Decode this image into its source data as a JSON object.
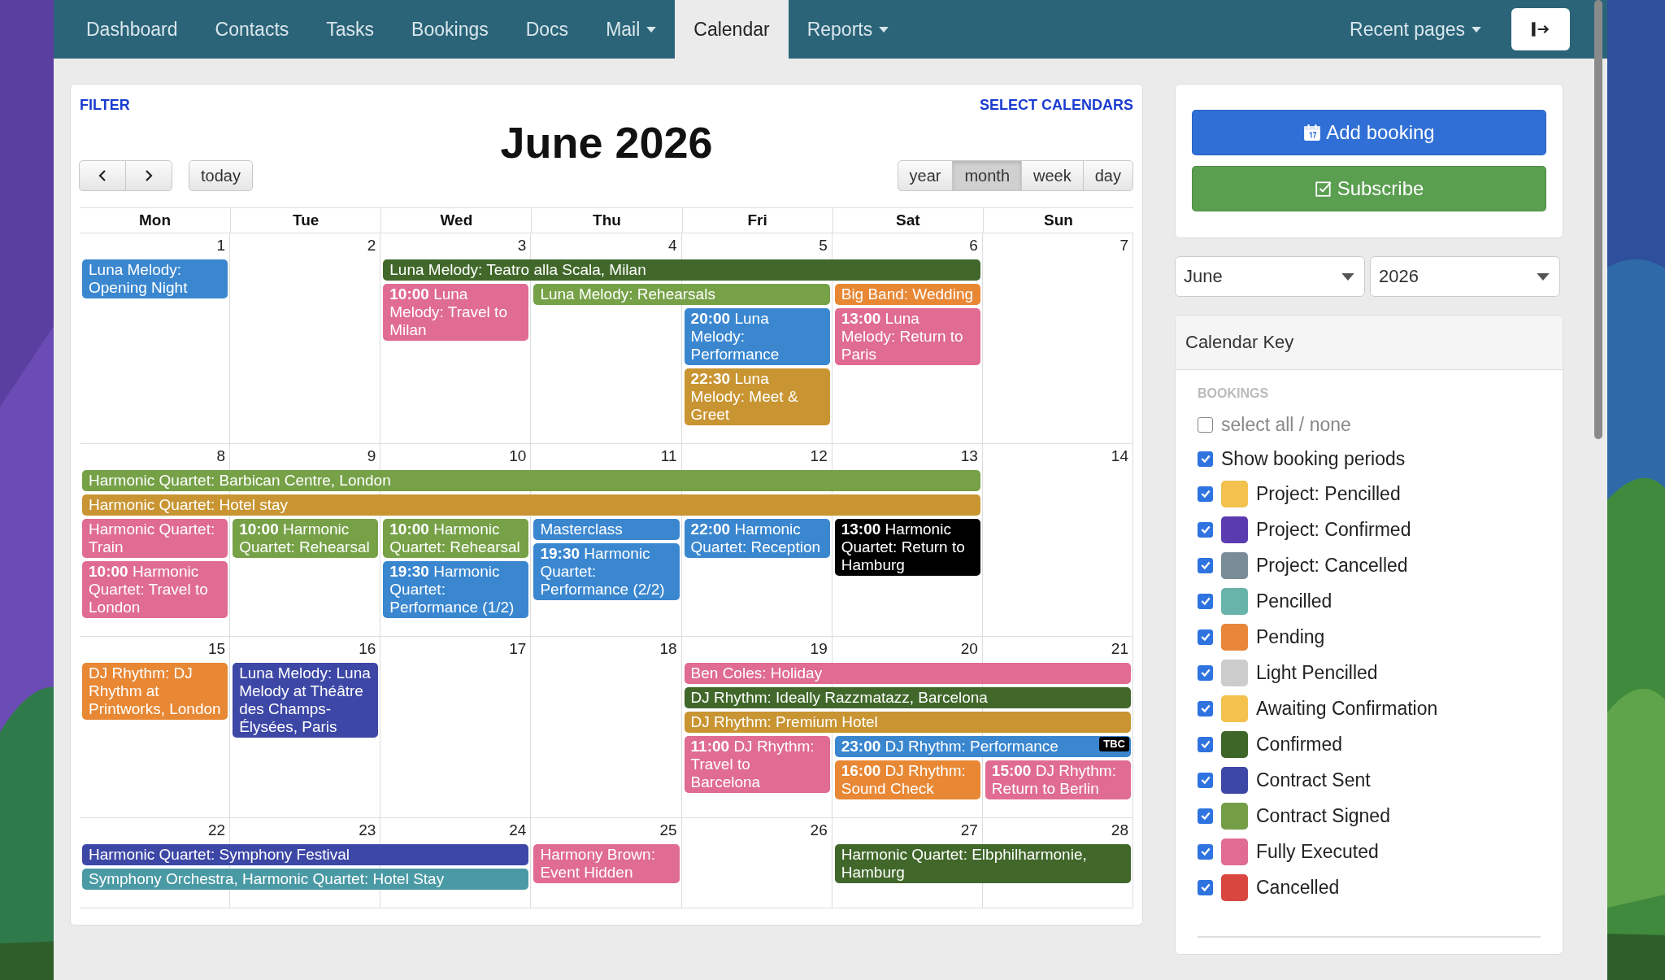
{
  "nav": {
    "items": [
      {
        "label": "Dashboard",
        "selected": false,
        "dropdown": false
      },
      {
        "label": "Contacts",
        "selected": false,
        "dropdown": false
      },
      {
        "label": "Tasks",
        "selected": false,
        "dropdown": false
      },
      {
        "label": "Bookings",
        "selected": false,
        "dropdown": false
      },
      {
        "label": "Docs",
        "selected": false,
        "dropdown": false
      },
      {
        "label": "Mail",
        "selected": false,
        "dropdown": true
      },
      {
        "label": "Calendar",
        "selected": true,
        "dropdown": false
      },
      {
        "label": "Reports",
        "selected": false,
        "dropdown": true
      }
    ],
    "recent": {
      "label": "Recent pages",
      "dropdown": true
    }
  },
  "calendar": {
    "filter": "FILTER",
    "select_calendars": "SELECT CALENDARS",
    "title": "June 2026",
    "today": "today",
    "views": [
      {
        "label": "year",
        "selected": false
      },
      {
        "label": "month",
        "selected": true
      },
      {
        "label": "week",
        "selected": false
      },
      {
        "label": "day",
        "selected": false
      }
    ],
    "weekdays": [
      "Mon",
      "Tue",
      "Wed",
      "Thu",
      "Fri",
      "Sat",
      "Sun"
    ],
    "weeks": [
      {
        "days": [
          {
            "date": "1",
            "events": [
              {
                "text": "Luna Melody: Opening Night",
                "color": "#3a87d0",
                "kind": "one-day"
              }
            ]
          },
          {
            "date": "2"
          },
          {
            "date": "3",
            "events": [
              {
                "text": "Luna Melody: Teatro alla Scala, Milan",
                "color": "#41682a",
                "kind": "four-days"
              },
              {
                "text": "**10:00** Luna Melody: Travel to Milan",
                "color": "#e06b93",
                "kind": "one-day"
              }
            ]
          },
          {
            "date": "4",
            "events": [
              {
                "text": "Luna Melody: Rehearsals",
                "color": "#76a147",
                "kind": "two-days"
              }
            ]
          },
          {
            "date": "5",
            "events": [
              {
                "text": "**20:00** Luna Melody: Performance",
                "color": "#3a87d0",
                "kind": "one-day"
              },
              {
                "text": "**22:30** Luna Melody: Meet & Greet",
                "color": "#c99532",
                "kind": "one-day"
              }
            ]
          },
          {
            "date": "6",
            "events": [
              {
                "text": "Big Band: Wedding",
                "color": "#e88734",
                "kind": "one-day"
              },
              {
                "text": "**13:00** Luna Melody: Return to Paris",
                "color": "#e06b93",
                "kind": "one-day"
              }
            ]
          },
          {
            "date": "7"
          }
        ]
      },
      {
        "days": [
          {
            "date": "8",
            "events": [
              {
                "text": "Harmonic Quartet: Barbican Centre, London",
                "color": "#76a147",
                "kind": "six-days"
              },
              {
                "text": "Harmonic Quartet: Hotel stay",
                "color": "#c99532",
                "kind": "six-days"
              },
              {
                "text": "Harmonic Quartet: Train",
                "color": "#e06b93",
                "kind": "one-day"
              },
              {
                "text": "**10:00** Harmonic Quartet: Travel to London",
                "color": "#e06b93",
                "kind": "one-day"
              }
            ]
          },
          {
            "date": "9",
            "events": [
              {
                "text": "**10:00** Harmonic Quartet: Rehearsal",
                "color": "#76a147",
                "kind": "one-day"
              }
            ]
          },
          {
            "date": "10",
            "events": [
              {
                "text": "**10:00** Harmonic Quartet: Rehearsal",
                "color": "#76a147",
                "kind": "one-day"
              },
              {
                "text": "**19:30** Harmonic Quartet: Performance (1/2)",
                "color": "#3a87d0",
                "kind": "one-day"
              }
            ]
          },
          {
            "date": "11",
            "events": [
              {
                "text": "Masterclass",
                "color": "#3a87d0",
                "kind": "one-day"
              },
              {
                "text": "**19:30** Harmonic Quartet: Performance (2/2)",
                "color": "#3a87d0",
                "kind": "one-day"
              }
            ]
          },
          {
            "date": "12",
            "events": [
              {
                "text": "**22:00** Harmonic Quartet: Reception",
                "color": "#3a87d0",
                "kind": "one-day"
              }
            ]
          },
          {
            "date": "13",
            "events": [
              {
                "text": "**13:00** Harmonic Quartet: Return to Hamburg",
                "color": "#000000",
                "kind": "one-day"
              }
            ]
          },
          {
            "date": "14"
          }
        ]
      },
      {
        "days": [
          {
            "date": "15",
            "events": [
              {
                "text": "DJ Rhythm: DJ Rhythm at Printworks, London",
                "color": "#e88734",
                "kind": "one-day"
              }
            ]
          },
          {
            "date": "16",
            "events": [
              {
                "text": "Luna Melody: Luna Melody at Théâtre des Champs-Élysées, Paris",
                "color": "#3d47a6",
                "kind": "one-day"
              }
            ]
          },
          {
            "date": "17"
          },
          {
            "date": "18"
          },
          {
            "date": "19",
            "events": [
              {
                "text": "Ben Coles: Holiday",
                "color": "#e06b93",
                "kind": "three-days"
              },
              {
                "text": "DJ Rhythm: Ideally Razzmatazz, Barcelona",
                "color": "#41682a",
                "kind": "three-days"
              },
              {
                "text": "DJ Rhythm: Premium Hotel",
                "color": "#c99532",
                "kind": "three-days"
              },
              {
                "text": "**11:00** DJ Rhythm: Travel to Barcelona",
                "color": "#e06b93",
                "kind": "one-day"
              }
            ]
          },
          {
            "date": "20",
            "events": [
              {
                "text": "**23:00** DJ Rhythm: Performance",
                "color": "#3a87d0",
                "kind": "two-days",
                "badge": "TBC"
              },
              {
                "text": "**16:00** DJ Rhythm: Sound Check",
                "color": "#e88734",
                "kind": "one-day"
              }
            ]
          },
          {
            "date": "21",
            "events": [
              {
                "text": "**15:00** DJ Rhythm: Return to Berlin",
                "color": "#e06b93",
                "kind": "one-day"
              }
            ]
          }
        ]
      },
      {
        "days": [
          {
            "date": "22",
            "events": [
              {
                "text": "Harmonic Quartet: Symphony Festival",
                "color": "#3d47a6",
                "kind": "three-days"
              },
              {
                "text": "Symphony Orchestra, Harmonic Quartet: Hotel Stay",
                "color": "#4a9aa5",
                "kind": "three-days"
              }
            ]
          },
          {
            "date": "23"
          },
          {
            "date": "24"
          },
          {
            "date": "25",
            "events": [
              {
                "text": "Harmony Brown: Event Hidden",
                "color": "#e06b93",
                "kind": "one-day"
              }
            ]
          },
          {
            "date": "26"
          },
          {
            "date": "27",
            "events": [
              {
                "text": "Harmonic Quartet: Elbphilharmonie, Hamburg",
                "color": "#41682a",
                "kind": "two-days"
              }
            ]
          },
          {
            "date": "28"
          }
        ]
      }
    ]
  },
  "sidebar": {
    "buttons": [
      {
        "label": "Add booking",
        "kind": "primary"
      },
      {
        "label": "Subscribe",
        "kind": "success"
      }
    ],
    "month": "June",
    "year": "2026",
    "key": {
      "title": "Calendar Key",
      "section": "BOOKINGS",
      "items": [
        {
          "label": "select all / none",
          "kind": "select-all",
          "checked": false
        },
        {
          "label": "Show booking periods",
          "kind": "option",
          "checked": true
        },
        {
          "label": "Project: Pencilled",
          "kind": "calendar",
          "checked": true,
          "color": "#f2c14e"
        },
        {
          "label": "Project: Confirmed",
          "kind": "calendar",
          "checked": true,
          "color": "#5b3bb0"
        },
        {
          "label": "Project: Cancelled",
          "kind": "calendar",
          "checked": true,
          "color": "#7b8c99"
        },
        {
          "label": "Pencilled",
          "kind": "calendar",
          "checked": true,
          "color": "#68b3aa"
        },
        {
          "label": "Pending",
          "kind": "calendar",
          "checked": true,
          "color": "#e8873a"
        },
        {
          "label": "Light Pencilled",
          "kind": "calendar",
          "checked": true,
          "color": "#cccccc"
        },
        {
          "label": "Awaiting Confirmation",
          "kind": "calendar",
          "checked": true,
          "color": "#f2c14e"
        },
        {
          "label": "Confirmed",
          "kind": "calendar",
          "checked": true,
          "color": "#3f6629"
        },
        {
          "label": "Contract Sent",
          "kind": "calendar",
          "checked": true,
          "color": "#3d47a5"
        },
        {
          "label": "Contract Signed",
          "kind": "calendar",
          "checked": true,
          "color": "#749e46"
        },
        {
          "label": "Fully Executed",
          "kind": "calendar",
          "checked": true,
          "color": "#e06c93"
        },
        {
          "label": "Cancelled",
          "kind": "calendar",
          "checked": true,
          "color": "#d9463f"
        }
      ]
    }
  }
}
